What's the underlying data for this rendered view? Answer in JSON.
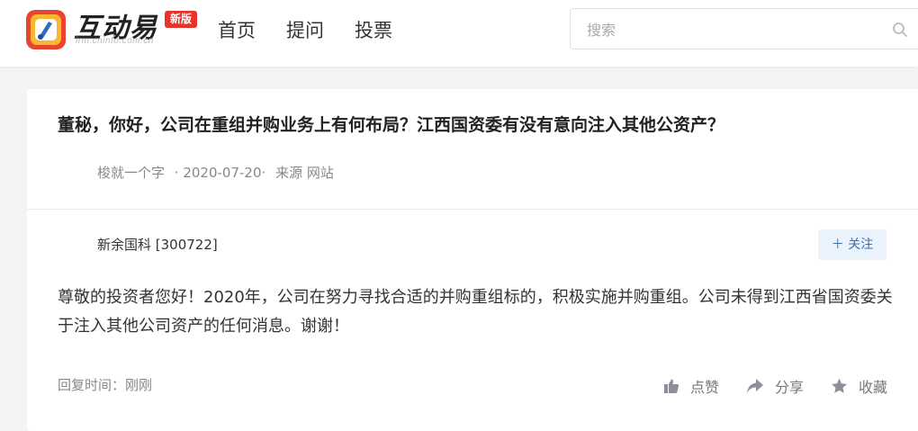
{
  "header": {
    "logo_text": "互动易",
    "logo_sub": "irm.cninfo.com.cn",
    "badge": "新版",
    "nav": [
      {
        "label": "首页"
      },
      {
        "label": "提问"
      },
      {
        "label": "投票"
      }
    ],
    "search": {
      "placeholder": "搜索",
      "value": "",
      "icon": "search-icon"
    }
  },
  "question": {
    "title": "董秘，你好，公司在重组并购业务上有何布局？江西国资委有没有意向注入其他公资产？",
    "author": "梭就一个字",
    "date": "· 2020-07-20·",
    "source": "来源 网站"
  },
  "answer": {
    "company": "新余国科 [300722]",
    "follow_label": "＋ 关注",
    "text": "尊敬的投资者您好！2020年，公司在努力寻找合适的并购重组标的，积极实施并购重组。公司未得到江西省国资委关于注入其他公司资产的任何消息。谢谢！",
    "reply_time": "回复时间：刚刚",
    "actions": [
      {
        "label": "点赞",
        "icon": "thumbs-up-icon"
      },
      {
        "label": "分享",
        "icon": "share-icon"
      },
      {
        "label": "收藏",
        "icon": "star-icon"
      }
    ]
  },
  "colors": {
    "brand_red": "#e8332a",
    "follow_bg": "#eaf2fb",
    "follow_text": "#3a6fb0",
    "page_bg": "#f3f4f6"
  }
}
